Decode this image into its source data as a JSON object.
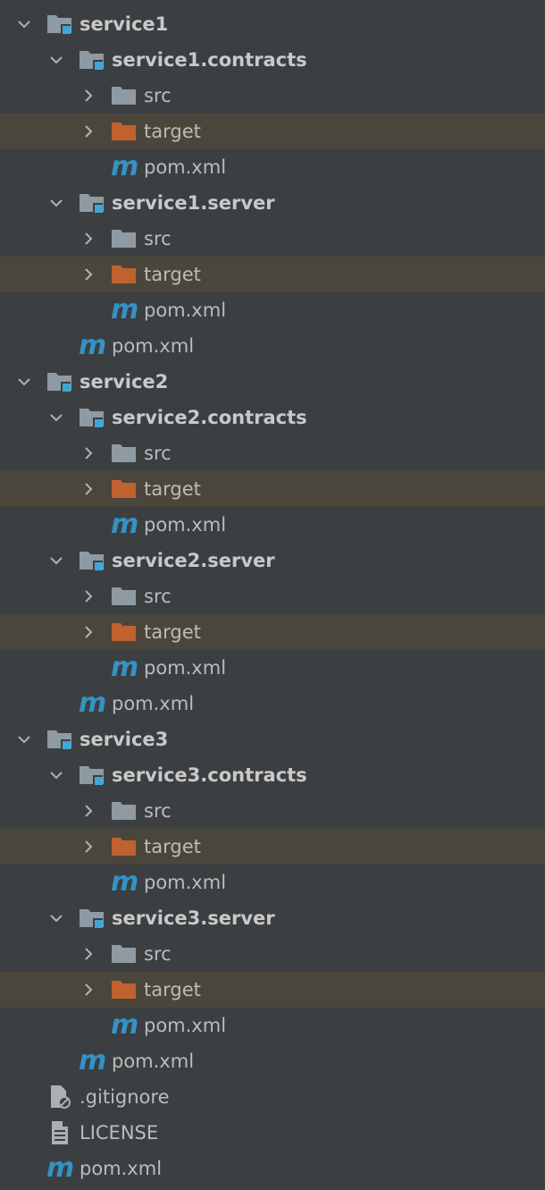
{
  "tree": {
    "rows": [
      {
        "label": "service1",
        "type": "module",
        "depth": 0,
        "expanded": true
      },
      {
        "label": "service1.contracts",
        "type": "module",
        "depth": 1,
        "expanded": true
      },
      {
        "label": "src",
        "type": "folder",
        "depth": 2,
        "expanded": false
      },
      {
        "label": "target",
        "type": "excluded-folder",
        "depth": 2,
        "expanded": false
      },
      {
        "label": "pom.xml",
        "type": "pom",
        "depth": 2
      },
      {
        "label": "service1.server",
        "type": "module",
        "depth": 1,
        "expanded": true
      },
      {
        "label": "src",
        "type": "folder",
        "depth": 2,
        "expanded": false
      },
      {
        "label": "target",
        "type": "excluded-folder",
        "depth": 2,
        "expanded": false
      },
      {
        "label": "pom.xml",
        "type": "pom",
        "depth": 2
      },
      {
        "label": "pom.xml",
        "type": "pom",
        "depth": 1
      },
      {
        "label": "service2",
        "type": "module",
        "depth": 0,
        "expanded": true
      },
      {
        "label": "service2.contracts",
        "type": "module",
        "depth": 1,
        "expanded": true
      },
      {
        "label": "src",
        "type": "folder",
        "depth": 2,
        "expanded": false
      },
      {
        "label": "target",
        "type": "excluded-folder",
        "depth": 2,
        "expanded": false
      },
      {
        "label": "pom.xml",
        "type": "pom",
        "depth": 2
      },
      {
        "label": "service2.server",
        "type": "module",
        "depth": 1,
        "expanded": true
      },
      {
        "label": "src",
        "type": "folder",
        "depth": 2,
        "expanded": false
      },
      {
        "label": "target",
        "type": "excluded-folder",
        "depth": 2,
        "expanded": false
      },
      {
        "label": "pom.xml",
        "type": "pom",
        "depth": 2
      },
      {
        "label": "pom.xml",
        "type": "pom",
        "depth": 1
      },
      {
        "label": "service3",
        "type": "module",
        "depth": 0,
        "expanded": true
      },
      {
        "label": "service3.contracts",
        "type": "module",
        "depth": 1,
        "expanded": true
      },
      {
        "label": "src",
        "type": "folder",
        "depth": 2,
        "expanded": false
      },
      {
        "label": "target",
        "type": "excluded-folder",
        "depth": 2,
        "expanded": false
      },
      {
        "label": "pom.xml",
        "type": "pom",
        "depth": 2
      },
      {
        "label": "service3.server",
        "type": "module",
        "depth": 1,
        "expanded": true
      },
      {
        "label": "src",
        "type": "folder",
        "depth": 2,
        "expanded": false
      },
      {
        "label": "target",
        "type": "excluded-folder",
        "depth": 2,
        "expanded": false
      },
      {
        "label": "pom.xml",
        "type": "pom",
        "depth": 2
      },
      {
        "label": "pom.xml",
        "type": "pom",
        "depth": 1
      },
      {
        "label": ".gitignore",
        "type": "gitignore",
        "depth": 0
      },
      {
        "label": "LICENSE",
        "type": "text-file",
        "depth": 0
      },
      {
        "label": "pom.xml",
        "type": "pom",
        "depth": 0
      }
    ]
  },
  "icons": {
    "chevron-down": "chevron-down-icon",
    "chevron-right": "chevron-right-icon",
    "module": "module-folder-icon",
    "folder": "folder-icon",
    "excluded-folder": "excluded-folder-icon",
    "pom": "maven-pom-icon",
    "gitignore": "gitignore-file-icon",
    "text-file": "text-file-icon",
    "pom_glyph": "m"
  },
  "colors": {
    "background": "#3c3f41",
    "excluded_row": "#4b463c",
    "text": "#bbbbbb",
    "folder": "#8f9aa3",
    "module_badge": "#3fa6d8",
    "excluded_folder": "#c0622f",
    "maven": "#3592c4"
  }
}
